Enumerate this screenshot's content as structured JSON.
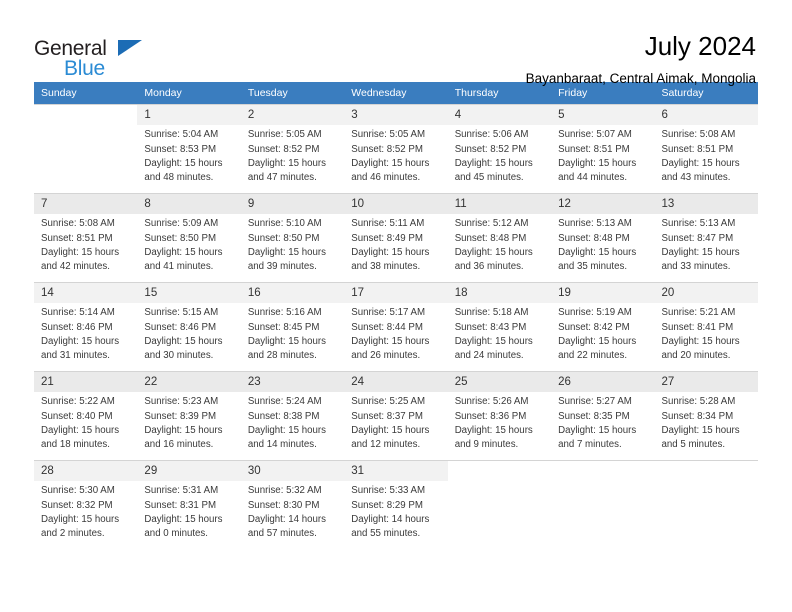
{
  "logo": {
    "word_top": "General",
    "word_bottom": "Blue",
    "top_color": "#231f20",
    "bottom_color": "#2b8bd4",
    "triangle_color": "#1c6cb5"
  },
  "header": {
    "title": "July 2024",
    "subtitle": "Bayanbaraat, Central Aimak, Mongolia"
  },
  "theme": {
    "header_row_bg": "#3a7dbf",
    "header_row_text": "#ffffff",
    "daynum_bg": "#f2f2f2",
    "grid_line": "#d4d4d4"
  },
  "calendar": {
    "weekday_headers": [
      "Sunday",
      "Monday",
      "Tuesday",
      "Wednesday",
      "Thursday",
      "Friday",
      "Saturday"
    ],
    "weeks": [
      [
        {
          "day": "",
          "info": ""
        },
        {
          "day": "1",
          "info": "Sunrise: 5:04 AM\nSunset: 8:53 PM\nDaylight: 15 hours and 48 minutes."
        },
        {
          "day": "2",
          "info": "Sunrise: 5:05 AM\nSunset: 8:52 PM\nDaylight: 15 hours and 47 minutes."
        },
        {
          "day": "3",
          "info": "Sunrise: 5:05 AM\nSunset: 8:52 PM\nDaylight: 15 hours and 46 minutes."
        },
        {
          "day": "4",
          "info": "Sunrise: 5:06 AM\nSunset: 8:52 PM\nDaylight: 15 hours and 45 minutes."
        },
        {
          "day": "5",
          "info": "Sunrise: 5:07 AM\nSunset: 8:51 PM\nDaylight: 15 hours and 44 minutes."
        },
        {
          "day": "6",
          "info": "Sunrise: 5:08 AM\nSunset: 8:51 PM\nDaylight: 15 hours and 43 minutes."
        }
      ],
      [
        {
          "day": "7",
          "info": "Sunrise: 5:08 AM\nSunset: 8:51 PM\nDaylight: 15 hours and 42 minutes."
        },
        {
          "day": "8",
          "info": "Sunrise: 5:09 AM\nSunset: 8:50 PM\nDaylight: 15 hours and 41 minutes."
        },
        {
          "day": "9",
          "info": "Sunrise: 5:10 AM\nSunset: 8:50 PM\nDaylight: 15 hours and 39 minutes."
        },
        {
          "day": "10",
          "info": "Sunrise: 5:11 AM\nSunset: 8:49 PM\nDaylight: 15 hours and 38 minutes."
        },
        {
          "day": "11",
          "info": "Sunrise: 5:12 AM\nSunset: 8:48 PM\nDaylight: 15 hours and 36 minutes."
        },
        {
          "day": "12",
          "info": "Sunrise: 5:13 AM\nSunset: 8:48 PM\nDaylight: 15 hours and 35 minutes."
        },
        {
          "day": "13",
          "info": "Sunrise: 5:13 AM\nSunset: 8:47 PM\nDaylight: 15 hours and 33 minutes."
        }
      ],
      [
        {
          "day": "14",
          "info": "Sunrise: 5:14 AM\nSunset: 8:46 PM\nDaylight: 15 hours and 31 minutes."
        },
        {
          "day": "15",
          "info": "Sunrise: 5:15 AM\nSunset: 8:46 PM\nDaylight: 15 hours and 30 minutes."
        },
        {
          "day": "16",
          "info": "Sunrise: 5:16 AM\nSunset: 8:45 PM\nDaylight: 15 hours and 28 minutes."
        },
        {
          "day": "17",
          "info": "Sunrise: 5:17 AM\nSunset: 8:44 PM\nDaylight: 15 hours and 26 minutes."
        },
        {
          "day": "18",
          "info": "Sunrise: 5:18 AM\nSunset: 8:43 PM\nDaylight: 15 hours and 24 minutes."
        },
        {
          "day": "19",
          "info": "Sunrise: 5:19 AM\nSunset: 8:42 PM\nDaylight: 15 hours and 22 minutes."
        },
        {
          "day": "20",
          "info": "Sunrise: 5:21 AM\nSunset: 8:41 PM\nDaylight: 15 hours and 20 minutes."
        }
      ],
      [
        {
          "day": "21",
          "info": "Sunrise: 5:22 AM\nSunset: 8:40 PM\nDaylight: 15 hours and 18 minutes."
        },
        {
          "day": "22",
          "info": "Sunrise: 5:23 AM\nSunset: 8:39 PM\nDaylight: 15 hours and 16 minutes."
        },
        {
          "day": "23",
          "info": "Sunrise: 5:24 AM\nSunset: 8:38 PM\nDaylight: 15 hours and 14 minutes."
        },
        {
          "day": "24",
          "info": "Sunrise: 5:25 AM\nSunset: 8:37 PM\nDaylight: 15 hours and 12 minutes."
        },
        {
          "day": "25",
          "info": "Sunrise: 5:26 AM\nSunset: 8:36 PM\nDaylight: 15 hours and 9 minutes."
        },
        {
          "day": "26",
          "info": "Sunrise: 5:27 AM\nSunset: 8:35 PM\nDaylight: 15 hours and 7 minutes."
        },
        {
          "day": "27",
          "info": "Sunrise: 5:28 AM\nSunset: 8:34 PM\nDaylight: 15 hours and 5 minutes."
        }
      ],
      [
        {
          "day": "28",
          "info": "Sunrise: 5:30 AM\nSunset: 8:32 PM\nDaylight: 15 hours and 2 minutes."
        },
        {
          "day": "29",
          "info": "Sunrise: 5:31 AM\nSunset: 8:31 PM\nDaylight: 15 hours and 0 minutes."
        },
        {
          "day": "30",
          "info": "Sunrise: 5:32 AM\nSunset: 8:30 PM\nDaylight: 14 hours and 57 minutes."
        },
        {
          "day": "31",
          "info": "Sunrise: 5:33 AM\nSunset: 8:29 PM\nDaylight: 14 hours and 55 minutes."
        },
        {
          "day": "",
          "info": ""
        },
        {
          "day": "",
          "info": ""
        },
        {
          "day": "",
          "info": ""
        }
      ]
    ]
  }
}
